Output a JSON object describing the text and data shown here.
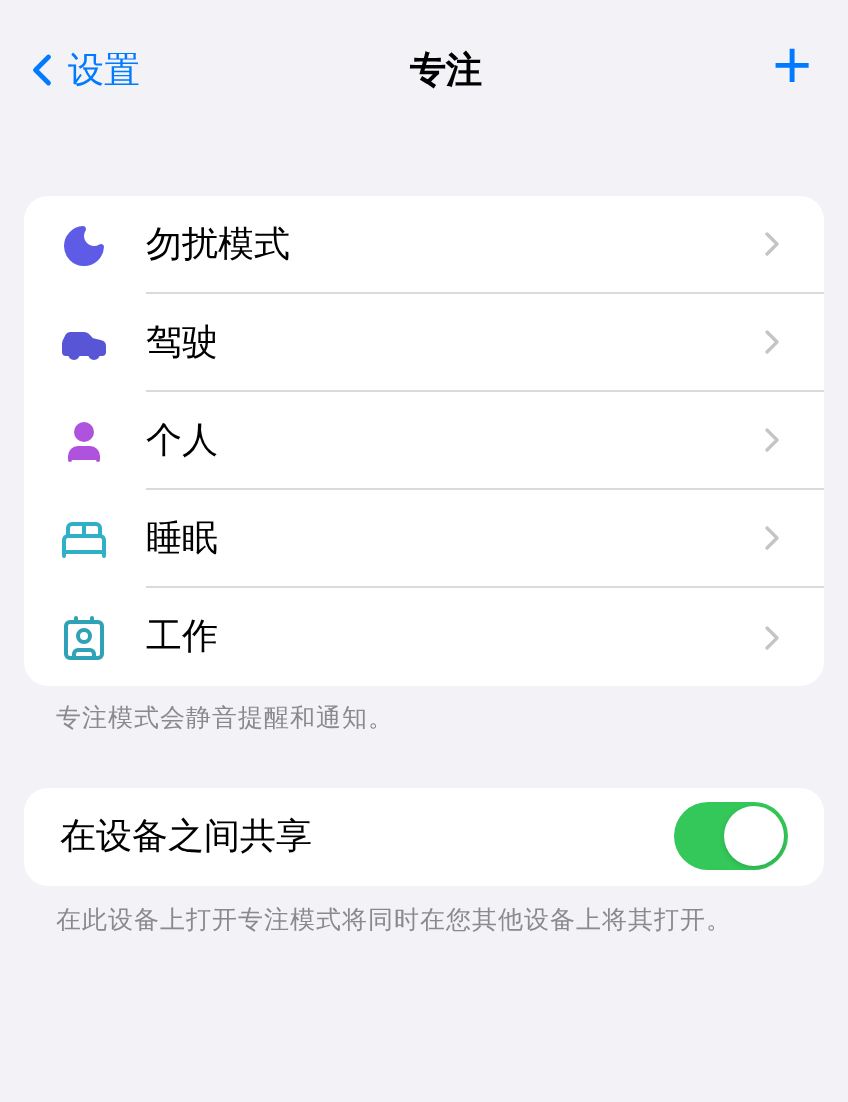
{
  "nav": {
    "back": "设置",
    "title": "专注",
    "add": "+"
  },
  "focus_modes": [
    {
      "label": "勿扰模式",
      "kind": "moon",
      "color": "#5e5ce6"
    },
    {
      "label": "驾驶",
      "kind": "car",
      "color": "#5856d6"
    },
    {
      "label": "个人",
      "kind": "person",
      "color": "#af52de"
    },
    {
      "label": "睡眠",
      "kind": "bed",
      "color": "#30b0c7"
    },
    {
      "label": "工作",
      "kind": "badge",
      "color": "#30a2b8"
    }
  ],
  "focus_footer": "专注模式会静音提醒和通知。",
  "share": {
    "label": "在设备之间共享",
    "on": true
  },
  "share_footer": "在此设备上打开专注模式将同时在您其他设备上将其打开。"
}
